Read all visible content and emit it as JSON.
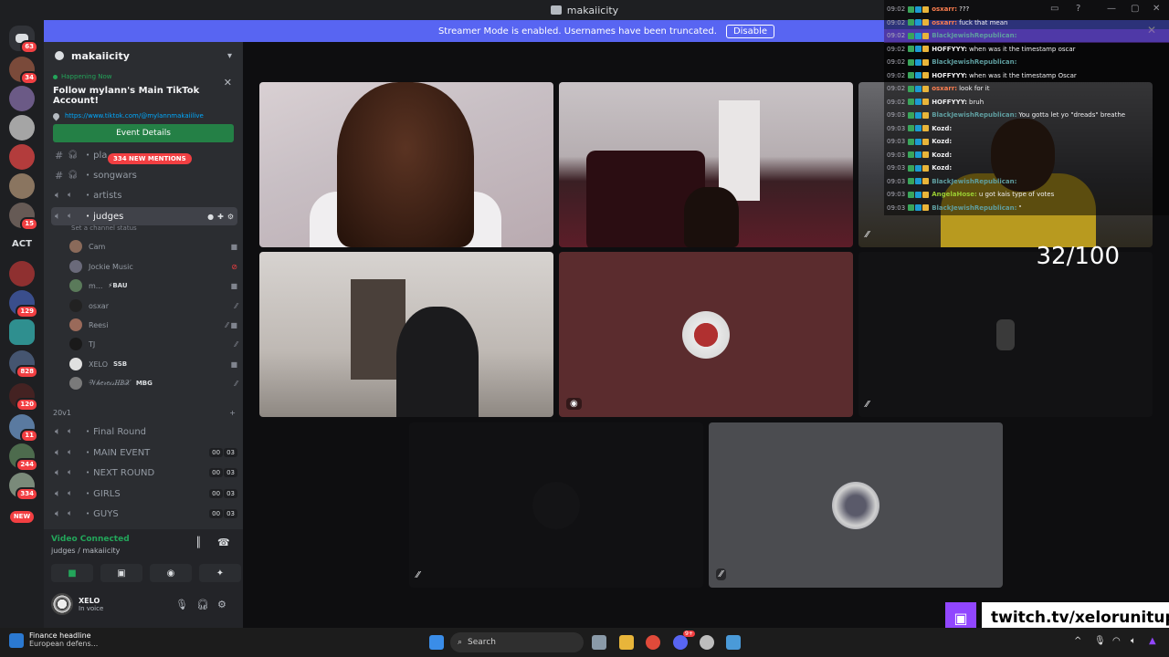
{
  "window": {
    "title": "makaiicity"
  },
  "banner": {
    "text": "Streamer Mode is enabled. Usernames have been truncated.",
    "button": "Disable",
    "close": "✕"
  },
  "rail": {
    "badges": [
      "63",
      "34",
      "15",
      "129",
      "828",
      "120",
      "11",
      "244",
      "334"
    ],
    "act_label": "ACT",
    "new_label": "NEW",
    "brand_color": "#5865f2"
  },
  "server": {
    "name": "makaiicity"
  },
  "event": {
    "status": "Happening Now",
    "title": "Follow mylann's Main TikTok Account!",
    "link": "https://www.tiktok.com/@mylannmakaiilive",
    "button": "Event Details"
  },
  "channels": {
    "mentions": "334 NEW MENTIONS",
    "list": [
      {
        "name": "pla...",
        "icon": "#"
      },
      {
        "name": "songwars",
        "icon": "#"
      },
      {
        "name": "artists",
        "icon": "speaker"
      },
      {
        "name": "judges",
        "icon": "speaker"
      }
    ],
    "status_hint": "Set a channel status",
    "users": [
      {
        "name": "Cam",
        "tag": ""
      },
      {
        "name": "Jockie Music",
        "tag": ""
      },
      {
        "name": "m...",
        "tag": "⚡BAU"
      },
      {
        "name": "osxar",
        "tag": ""
      },
      {
        "name": "Reesi",
        "tag": ""
      },
      {
        "name": "TJ",
        "tag": ""
      },
      {
        "name": "XELO",
        "tag": "SSB"
      },
      {
        "name": "𝒲𝒽𝑒𝓇𝑒𝒾𝓈𝐻𝐵𝒳",
        "tag": "MBG"
      }
    ],
    "category": "20v1",
    "voice": [
      {
        "name": "Final Round",
        "left": "",
        "right": ""
      },
      {
        "name": "MAIN EVENT",
        "left": "00",
        "right": "03"
      },
      {
        "name": "NEXT ROUND",
        "left": "00",
        "right": "03"
      },
      {
        "name": "GIRLS",
        "left": "00",
        "right": "03"
      },
      {
        "name": "GUYS",
        "left": "00",
        "right": "03"
      }
    ]
  },
  "voice_panel": {
    "status": "Video Connected",
    "location": "judges / makaiicity"
  },
  "me": {
    "name": "XELO",
    "status": "In voice"
  },
  "stage": {
    "counter": "32/100"
  },
  "chat": [
    {
      "t": "09:02",
      "u": "osxarr:",
      "c": "#ff7f50",
      "m": "???"
    },
    {
      "t": "09:02",
      "u": "osxarr:",
      "c": "#ff7f50",
      "m": "fuck that mean"
    },
    {
      "t": "09:02",
      "u": "BlackJewishRepublican:",
      "c": "#5f9ea0",
      "m": "",
      "hl": true
    },
    {
      "t": "09:02",
      "u": "HOFFYYY:",
      "c": "#efeff1",
      "m": "when was it the timestamp oscar"
    },
    {
      "t": "09:02",
      "u": "BlackJewishRepublican:",
      "c": "#5f9ea0",
      "m": ""
    },
    {
      "t": "09:02",
      "u": "HOFFYYY:",
      "c": "#efeff1",
      "m": "when was it the timestamp Oscar"
    },
    {
      "t": "09:02",
      "u": "osxarr:",
      "c": "#ff7f50",
      "m": "look for it"
    },
    {
      "t": "09:02",
      "u": "HOFFYYY:",
      "c": "#efeff1",
      "m": "bruh"
    },
    {
      "t": "09:03",
      "u": "BlackJewishRepublican:",
      "c": "#5f9ea0",
      "m": "You gotta let yo \"dreads\" breathe"
    },
    {
      "t": "09:03",
      "u": "Kozd:",
      "c": "#efeff1",
      "m": ""
    },
    {
      "t": "09:03",
      "u": "Kozd:",
      "c": "#efeff1",
      "m": ""
    },
    {
      "t": "09:03",
      "u": "Kozd:",
      "c": "#efeff1",
      "m": ""
    },
    {
      "t": "09:03",
      "u": "Kozd:",
      "c": "#efeff1",
      "m": ""
    },
    {
      "t": "09:03",
      "u": "BlackJewishRepublican:",
      "c": "#5f9ea0",
      "m": ""
    },
    {
      "t": "09:03",
      "u": "AngelaHose:",
      "c": "#9acd32",
      "m": "u got kais type of votes"
    },
    {
      "t": "09:03",
      "u": "BlackJewishRepublican:",
      "c": "#5f9ea0",
      "m": "\""
    }
  ],
  "twitch": {
    "handle": "twitch.tv/xelorunitup",
    "color": "#9146ff"
  },
  "taskbar": {
    "news_title": "Finance headline",
    "news_sub": "European defens...",
    "search": "Search",
    "notif": "9+"
  }
}
